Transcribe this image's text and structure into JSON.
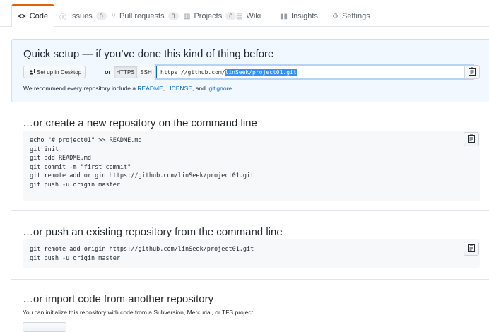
{
  "tabs": [
    {
      "label": "Code",
      "icon": "code-icon",
      "count": null
    },
    {
      "label": "Issues",
      "icon": "issue-icon",
      "count": "0"
    },
    {
      "label": "Pull requests",
      "icon": "pull-request-icon",
      "count": "0"
    },
    {
      "label": "Projects",
      "icon": "project-icon",
      "count": "0"
    },
    {
      "label": "Wiki",
      "icon": "book-icon",
      "count": null
    },
    {
      "label": "Insights",
      "icon": "graph-icon",
      "count": null
    },
    {
      "label": "Settings",
      "icon": "gear-icon",
      "count": null
    }
  ],
  "quick_setup": {
    "title": "Quick setup — if you’ve done this kind of thing before",
    "desktop_button": "Set up in Desktop",
    "or": "or",
    "https_button": "HTTPS",
    "ssh_button": "SSH",
    "url_prefix": "https://github.com/",
    "url_selected": "linSeek/project01.git",
    "recommend_prefix": "We recommend every repository include a ",
    "readme_link": "README",
    "sep1": ", ",
    "license_link": "LICENSE",
    "sep2": ", and ",
    "gitignore_link": ".gitignore",
    "period": "."
  },
  "new_repo": {
    "title": "…or create a new repository on the command line",
    "lines": [
      "echo \"# project01\" >> README.md",
      "git init",
      "git add README.md",
      "git commit -m \"first commit\"",
      "git remote add origin https://github.com/linSeek/project01.git",
      "git push -u origin master"
    ]
  },
  "push_existing": {
    "title": "…or push an existing repository from the command line",
    "lines": [
      "git remote add origin https://github.com/linSeek/project01.git",
      "git push -u origin master"
    ]
  },
  "import_code": {
    "title": "…or import code from another repository",
    "description": "You can initialize this repository with code from a Subversion, Mercurial, or TFS project."
  },
  "colors": {
    "accent": "#e36209",
    "link": "#0366d6",
    "quick_bg": "#f1f8ff",
    "code_bg": "#f6f8fa"
  }
}
